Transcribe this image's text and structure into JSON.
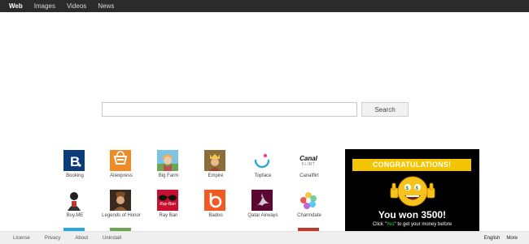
{
  "nav": {
    "items": [
      {
        "label": "Web"
      },
      {
        "label": "Images"
      },
      {
        "label": "Videos"
      },
      {
        "label": "News"
      }
    ]
  },
  "search": {
    "placeholder": "",
    "button_label": "Search"
  },
  "tiles": [
    {
      "label": "Booking",
      "icon": "booking-icon"
    },
    {
      "label": "Aliexpress",
      "icon": "aliexpress-icon"
    },
    {
      "label": "Big Farm",
      "icon": "big-farm-icon"
    },
    {
      "label": "Empire",
      "icon": "empire-icon"
    },
    {
      "label": "Topface",
      "icon": "topface-icon"
    },
    {
      "label": "Canalflirt",
      "icon": "canalflirt-icon",
      "logo_text": "Canal",
      "logo_sub": "FLIRT"
    },
    {
      "label": "Buy.ME",
      "icon": "buyme-icon"
    },
    {
      "label": "Legends of Honor",
      "icon": "legends-of-honor-icon"
    },
    {
      "label": "Ray Ban",
      "icon": "ray-ban-icon",
      "logo_text": "Ray-Ban"
    },
    {
      "label": "Badoo",
      "icon": "badoo-icon"
    },
    {
      "label": "Qatar Airways",
      "icon": "qatar-airways-icon"
    },
    {
      "label": "Charmdate",
      "icon": "charmdate-icon"
    }
  ],
  "ad": {
    "banner": "CONGRATULATIONS!",
    "headline": "You won 3500!",
    "sub_prefix": "Click \"",
    "sub_yes": "Yes",
    "sub_suffix": "\" to get your money before"
  },
  "footer": {
    "links": [
      {
        "label": "License"
      },
      {
        "label": "Privacy"
      },
      {
        "label": "About"
      },
      {
        "label": "Uninstall"
      }
    ],
    "language": "English",
    "more": "More"
  },
  "colors": {
    "topbar": "#2b2b2b",
    "booking": "#0c3b7c",
    "aliexpress": "#f08a24",
    "badoo": "#f15a22",
    "ray_ban": "#c8102e",
    "qatar": "#5c0632",
    "ad_banner": "#f5c400"
  }
}
